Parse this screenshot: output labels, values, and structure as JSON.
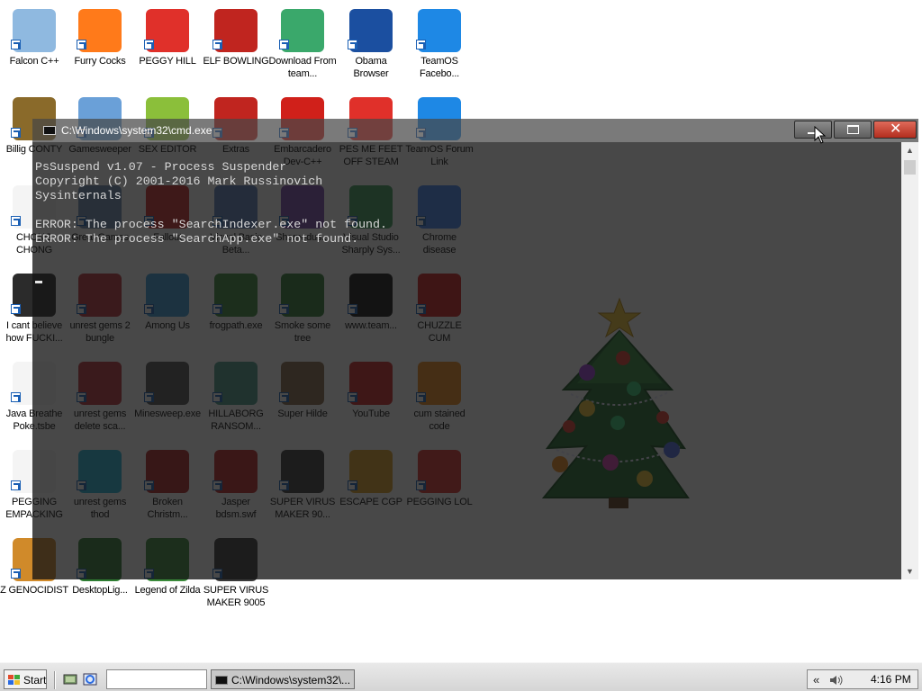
{
  "desktop": {
    "icons": [
      {
        "label": "Falcon C++",
        "icon": "recycle-bin-icon",
        "color": "#8fb9e0"
      },
      {
        "label": "Furry Cocks",
        "icon": "firefox-icon",
        "color": "#ff7a1a"
      },
      {
        "label": "PEGGY HILL",
        "icon": "p-logo-icon",
        "color": "#e0302a"
      },
      {
        "label": "ELF BOWLING",
        "icon": "elf-bowling-icon",
        "color": "#c0251f"
      },
      {
        "label": "Download From team...",
        "icon": "notepad-icon",
        "color": "#3aa86b"
      },
      {
        "label": "Obama Browser",
        "icon": "obama-logo-icon",
        "color": "#1b4fa0"
      },
      {
        "label": "TeamOS Facebo...",
        "icon": "gear-icon",
        "color": "#1e88e5"
      },
      {
        "label": "Billig CONTY",
        "icon": "money-bag-icon",
        "color": "#8a6a2a"
      },
      {
        "label": "Gamesweeper",
        "icon": "globe-face-icon",
        "color": "#6aa0d8"
      },
      {
        "label": "SEX EDITOR",
        "icon": "hex-editor-icon",
        "color": "#8bbf3a"
      },
      {
        "label": "Extras",
        "icon": "extras-icon",
        "color": "#c0251f"
      },
      {
        "label": "Embarcadero Dev-C++",
        "icon": "devcpp-icon",
        "color": "#d0201a"
      },
      {
        "label": "PES ME FEET OFF STEAM",
        "icon": "p-logo-icon",
        "color": "#e0302a"
      },
      {
        "label": "TeamOS Forum Link",
        "icon": "gear-icon",
        "color": "#1e88e5"
      },
      {
        "label": "CHONG CHONG",
        "icon": "document-icon",
        "color": "#f4f4f4"
      },
      {
        "label": "Great Games",
        "icon": "folder-icon",
        "color": "#6e8fb5"
      },
      {
        "label": "Fallout",
        "icon": "radiation-icon",
        "color": "#d02a2a"
      },
      {
        "label": "Visual Basic Beta...",
        "icon": "vb-icon",
        "color": "#5a7fc0"
      },
      {
        "label": "Shamedus...",
        "icon": "character-icon",
        "color": "#7a4ab0"
      },
      {
        "label": "Visual Studio Sharply Sys...",
        "icon": "csharp-icon",
        "color": "#3d9e5a"
      },
      {
        "label": "Chrome disease",
        "icon": "chrome-icon",
        "color": "#4285f4"
      },
      {
        "label": "I cant believe how FUCKI...",
        "icon": "hat-icon",
        "color": "#2b2b2b"
      },
      {
        "label": "unrest gems 2 bungle",
        "icon": "gem-icon",
        "color": "#c0303a"
      },
      {
        "label": "Among Us",
        "icon": "among-us-icon",
        "color": "#3a9ad8"
      },
      {
        "label": "frogpath.exe",
        "icon": "frog-icon",
        "color": "#3a8a3a"
      },
      {
        "label": "Smoke some tree",
        "icon": "tree-icon",
        "color": "#2e7d32"
      },
      {
        "label": "www.team...",
        "icon": "black-device-icon",
        "color": "#111111"
      },
      {
        "label": "CHUZZLE CUM",
        "icon": "chuzzle-icon",
        "color": "#d01a1a"
      },
      {
        "label": "Java Breathe Poke.tsbe",
        "icon": "document-icon",
        "color": "#f4f4f4"
      },
      {
        "label": "unrest gems delete sca...",
        "icon": "gem-icon",
        "color": "#c0303a"
      },
      {
        "label": "Minesweep.exe",
        "icon": "minesweeper-icon",
        "color": "#555555"
      },
      {
        "label": "HILLABORG RANSOM...",
        "icon": "worms-icon",
        "color": "#4a9a8a"
      },
      {
        "label": "Super Hilde",
        "icon": "super-hilde-icon",
        "color": "#8a6a4a"
      },
      {
        "label": "YouTube",
        "icon": "angry-bird-icon",
        "color": "#d02020"
      },
      {
        "label": "cum stained code",
        "icon": "traffic-cone-icon",
        "color": "#f08a1a"
      },
      {
        "label": "PEGGING EMPACKING",
        "icon": "document-icon",
        "color": "#f4f4f4"
      },
      {
        "label": "unrest gems thod",
        "icon": "diamond-icon",
        "color": "#22b8d8"
      },
      {
        "label": "Broken Christm...",
        "icon": "ornament-icon",
        "color": "#b02020"
      },
      {
        "label": "Jasper bdsm.swf",
        "icon": "flash-icon",
        "color": "#c02020"
      },
      {
        "label": "SUPER VIRUS MAKER 90...",
        "icon": "bag-icon",
        "color": "#3a3a3a"
      },
      {
        "label": "ESCAPE CGP",
        "icon": "escape-icon",
        "color": "#e0a020"
      },
      {
        "label": "PEGGING LOL",
        "icon": "p-logo-icon",
        "color": "#e0302a"
      },
      {
        "label": "Z GENOCIDIST",
        "icon": "z-icon",
        "color": "#d08a2a"
      },
      {
        "label": "DesktopLig...",
        "icon": "tree-icon",
        "color": "#2e7d32"
      },
      {
        "label": "Legend of Zilda",
        "icon": "link-icon",
        "color": "#3a8a3a"
      },
      {
        "label": "SUPER VIRUS MAKER 9005",
        "icon": "bag-icon",
        "color": "#3a3a3a"
      }
    ]
  },
  "cmd_window": {
    "title": "C:\\Windows\\system32\\cmd.exe",
    "output": "PsSuspend v1.07 - Process Suspender\nCopyright (C) 2001-2016 Mark Russinovich\nSysinternals\n\nERROR: The process \"SearchIndexer.exe\" not found.\nERROR: The process \"SearchApp.exe\" not found."
  },
  "taskbar": {
    "start_label": "Start",
    "task_button_label": "C:\\Windows\\system32\\...",
    "tray_chevron": "«",
    "clock": "4:16 PM"
  }
}
